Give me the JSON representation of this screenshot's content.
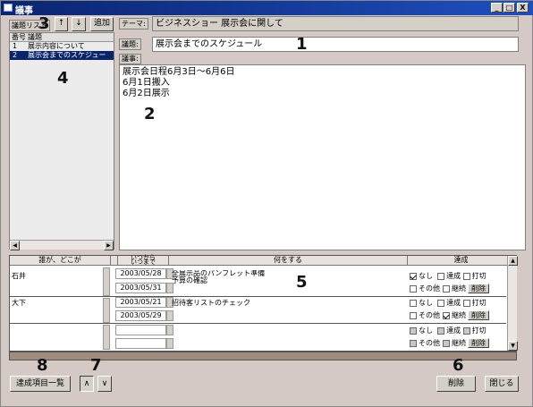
{
  "window": {
    "title": "議事",
    "min": "_",
    "max": "□",
    "close": "X"
  },
  "topic_list": {
    "label": "議題リスト",
    "up": "↑",
    "down": "↓",
    "add": "追加",
    "col_no": "番号",
    "col_topic": "議題",
    "items": [
      {
        "no": "1",
        "topic": "展示内容について"
      },
      {
        "no": "2",
        "topic": "展示会までのスケジュー"
      }
    ]
  },
  "theme": {
    "label": "テーマ:",
    "value": "ビジネスショー 展示会に関して"
  },
  "subject": {
    "label": "議題:",
    "value": "展示会までのスケジュール"
  },
  "minutes": {
    "label": "議事:",
    "lines": [
      "展示会日程6月3日～6月6日",
      "6月1日搬入",
      "6月2日展示"
    ]
  },
  "markers": {
    "m1": "1",
    "m2": "2",
    "m3": "3",
    "m4": "4",
    "m5": "5",
    "m6": "6",
    "m7": "7",
    "m8": "8"
  },
  "actions": {
    "headers": {
      "who": "誰が、どこが",
      "from": "いつから",
      "to": "いつまで",
      "what": "何をする",
      "status": "達成"
    },
    "status_opts": {
      "none": "なし",
      "done": "達成",
      "cut": "打切",
      "other": "その他",
      "cont": "継続",
      "delete": "削除"
    },
    "rows": [
      {
        "who": "石井",
        "from": "2003/05/28",
        "to": "2003/05/31",
        "what1": "全展示品のパンフレット準備",
        "what2": "予算の確認"
      },
      {
        "who": "大下",
        "from": "2003/05/21",
        "to": "2003/05/29",
        "what1": "招待客リストのチェック",
        "what2": ""
      }
    ]
  },
  "footer": {
    "list_button": "達成項目一覧",
    "sort_asc": "∧",
    "sort_desc": "∨",
    "delete": "削除",
    "close": "閉じる"
  }
}
